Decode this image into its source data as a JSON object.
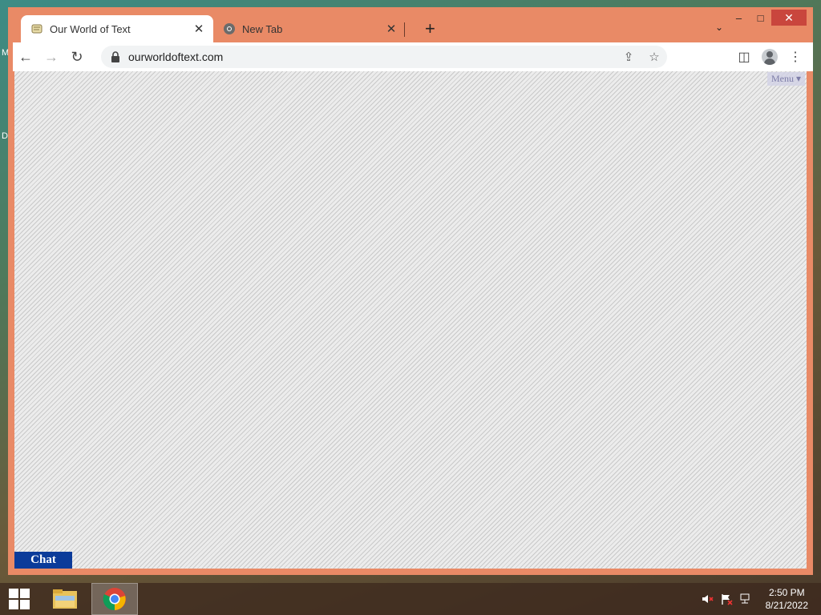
{
  "desktop": {
    "edge_letters": [
      "M",
      "D"
    ]
  },
  "window_controls": {
    "minimize": "–",
    "maximize": "□",
    "close": "✕"
  },
  "tabs": [
    {
      "title": "Our World of Text",
      "close": "✕",
      "active": true
    },
    {
      "title": "New Tab",
      "close": "✕",
      "active": false
    }
  ],
  "new_tab_glyph": "+",
  "tab_search_glyph": "⌄",
  "toolbar": {
    "back": "←",
    "forward": "→",
    "reload": "↻",
    "url": "ourworldoftext.com",
    "share": "⇪",
    "bookmark": "☆",
    "side_panel": "◫",
    "menu": "⋮"
  },
  "page": {
    "menu_label": "Menu ▾",
    "chat_label": "Chat"
  },
  "taskbar": {
    "time": "2:50 PM",
    "date": "8/21/2022"
  },
  "colors": {
    "window_frame": "#e98a66",
    "chat_button": "#0b3b9a",
    "close_button": "#c9463d"
  }
}
